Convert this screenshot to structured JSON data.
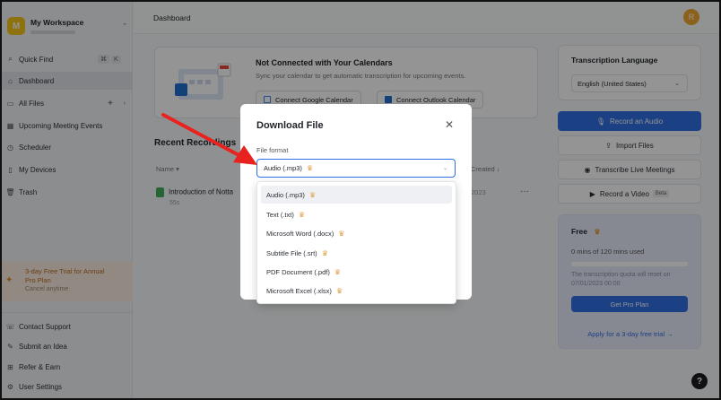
{
  "workspace": {
    "name": "My Workspace",
    "initial": "M"
  },
  "sidebar": {
    "quick_find": "Quick Find",
    "quick_find_keys": [
      "⌘",
      "K"
    ],
    "items": [
      {
        "label": "Dashboard"
      },
      {
        "label": "All Files"
      },
      {
        "label": "Upcoming Meeting Events"
      },
      {
        "label": "Scheduler"
      },
      {
        "label": "My Devices"
      },
      {
        "label": "Trash"
      }
    ],
    "trial": {
      "line1": "3-day Free Trial for Annual",
      "line2": "Pro Plan",
      "line3": "Cancel anytime"
    },
    "bottom": [
      {
        "label": "Contact Support"
      },
      {
        "label": "Submit an Idea"
      },
      {
        "label": "Refer & Earn"
      },
      {
        "label": "User Settings"
      }
    ]
  },
  "header": {
    "breadcrumb": "Dashboard",
    "avatar_initial": "R"
  },
  "calendar_card": {
    "title": "Not Connected with Your Calendars",
    "subtitle": "Sync your calendar to get automatic transcription for upcoming events.",
    "google_btn": "Connect Google Calendar",
    "outlook_btn": "Connect Outlook Calendar"
  },
  "recent": {
    "title": "Recent Recordings",
    "name_col": "Name",
    "date_col": "Created",
    "item_name": "Introduction of Notta",
    "item_sub": "55s",
    "item_date": "2023"
  },
  "right_panel": {
    "lang_title": "Transcription Language",
    "lang_value": "English (United States)",
    "record_btn": "Record an Audio",
    "import_btn": "Import Files",
    "transcribe_btn": "Transcribe Live Meetings",
    "video_btn": "Record a Video",
    "video_badge": "Beta"
  },
  "plan": {
    "title": "Free",
    "usage": "0 mins of 120 mins used",
    "usage_fraction": 0,
    "note": "The transcription quota will reset on 07/01/2023 00:00",
    "pro_btn": "Get Pro Plan",
    "trial_link": "Apply for a 3-day free trial →"
  },
  "modal": {
    "title": "Download File",
    "format_label": "File format",
    "selected": "Audio (.mp3)",
    "options": [
      {
        "label": "Audio (.mp3)"
      },
      {
        "label": "Text (.txt)"
      },
      {
        "label": "Microsoft Word (.docx)"
      },
      {
        "label": "Subtitle File (.srt)"
      },
      {
        "label": "PDF Document (.pdf)"
      },
      {
        "label": "Microsoft Excel (.xlsx)"
      }
    ]
  },
  "colors": {
    "accent": "#2f6fe4",
    "annotation_arrow": "#e8231f",
    "crown": "#e3a04a"
  },
  "icons": [
    "search-icon",
    "home-icon",
    "folder-icon",
    "calendar-icon",
    "clock-icon",
    "device-icon",
    "trash-icon",
    "support-icon",
    "idea-icon",
    "gift-icon",
    "settings-icon",
    "close-icon",
    "crown-icon",
    "microphone-icon",
    "upload-icon",
    "broadcast-icon",
    "video-icon",
    "help-icon"
  ]
}
